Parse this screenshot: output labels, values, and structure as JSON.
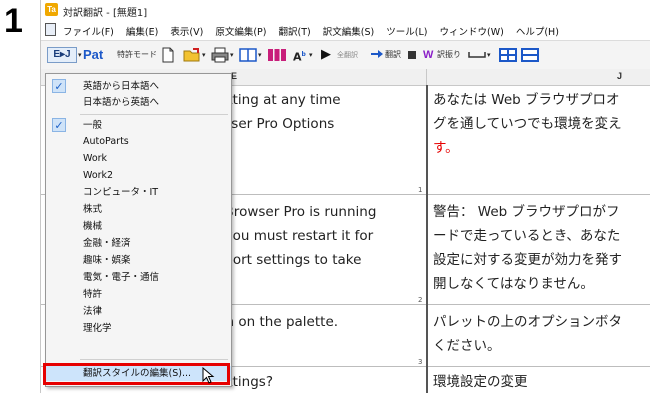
{
  "step_number": "1",
  "window": {
    "title": "対訳翻訳 - [無題1]",
    "app_icon_text": "Ta"
  },
  "menu": [
    "ファイル(F)",
    "編集(E)",
    "表示(V)",
    "原文編集(P)",
    "翻訳(T)",
    "訳文編集(S)",
    "ツール(L)",
    "ウィンドウ(W)",
    "ヘルプ(H)"
  ],
  "toolbar": {
    "ij_label": "E▸J",
    "pat_label": "Pat",
    "tokkyo_label": "特許モード",
    "zenyaku_label": "全翻訳",
    "honyaku_label": "翻訳",
    "yakufuri_label": "訳振り"
  },
  "grid": {
    "col_e": "E",
    "col_j": "J",
    "english_lines": [
      "setting at any time",
      "owser Pro Options",
      "o Browser Pro is running",
      "e,you must restart it for",
      "y port settings to take",
      "ton on the palette.",
      "settings?"
    ],
    "japanese_lines": [
      "あなたは Web ブラウザプロオ",
      "グを通していつでも環境を変え",
      "す。",
      "警告： Web ブラウザプロがフ",
      "ードで走っているとき、あなた",
      "設定に対する変更が効力を発す",
      "開しなくてはなりません。",
      "パレットの上のオプションボタ",
      "ください。",
      "環境設定の変更"
    ],
    "row_markers": [
      "1",
      "2",
      "3"
    ]
  },
  "dropdown": {
    "items": [
      {
        "label": "英語から日本語へ",
        "checked": true
      },
      {
        "label": "日本語から英語へ",
        "checked": false
      },
      {
        "label": "一般",
        "checked": true
      },
      {
        "label": "AutoParts",
        "checked": false
      },
      {
        "label": "Work",
        "checked": false
      },
      {
        "label": "Work2",
        "checked": false
      },
      {
        "label": "コンピュータ・IT",
        "checked": false
      },
      {
        "label": "株式",
        "checked": false
      },
      {
        "label": "機械",
        "checked": false
      },
      {
        "label": "金融・経済",
        "checked": false
      },
      {
        "label": "趣味・娯楽",
        "checked": false
      },
      {
        "label": "電気・電子・通信",
        "checked": false
      },
      {
        "label": "特許",
        "checked": false
      },
      {
        "label": "法律",
        "checked": false
      },
      {
        "label": "理化学",
        "checked": false
      }
    ],
    "edit_style_label": "翻訳スタイルの編集(S)..."
  },
  "colors": {
    "highlight_red": "#e60000",
    "check_blue": "#1e62c8",
    "japanese_red_period": "#e60000"
  }
}
